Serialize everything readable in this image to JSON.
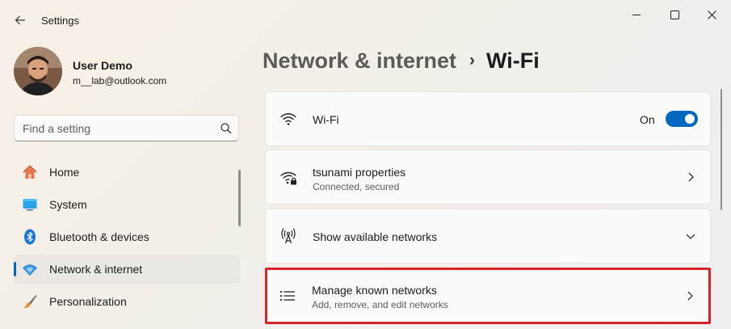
{
  "window": {
    "title": "Settings",
    "back_icon": "arrow-left-icon",
    "controls": {
      "minimize_icon": "minimize-icon",
      "maximize_icon": "maximize-icon",
      "close_icon": "close-icon"
    }
  },
  "user": {
    "name": "User Demo",
    "email": "m__lab@outlook.com"
  },
  "search": {
    "placeholder": "Find a setting",
    "value": "",
    "icon": "search-icon"
  },
  "sidebar": {
    "items": [
      {
        "label": "Home",
        "icon": "home-icon",
        "selected": false
      },
      {
        "label": "System",
        "icon": "monitor-icon",
        "selected": false
      },
      {
        "label": "Bluetooth & devices",
        "icon": "bluetooth-icon",
        "selected": false
      },
      {
        "label": "Network & internet",
        "icon": "wifi-diamond-icon",
        "selected": true
      },
      {
        "label": "Personalization",
        "icon": "paintbrush-icon",
        "selected": false
      }
    ]
  },
  "breadcrumb": {
    "parent": "Network & internet",
    "separator": "›",
    "current": "Wi-Fi"
  },
  "cards": {
    "wifi": {
      "title": "Wi-Fi",
      "icon": "wifi-icon",
      "toggle_state": "On",
      "toggle_on": true
    },
    "properties": {
      "title": "tsunami properties",
      "subtitle": "Connected, secured",
      "icon": "wifi-lock-icon",
      "action_icon": "chevron-right-icon"
    },
    "available": {
      "title": "Show available networks",
      "icon": "antenna-icon",
      "action_icon": "chevron-down-icon"
    },
    "known": {
      "title": "Manage known networks",
      "subtitle": "Add, remove, and edit networks",
      "icon": "list-icon",
      "action_icon": "chevron-right-icon"
    }
  },
  "colors": {
    "accent": "#0067c0",
    "highlight_border": "#d8232a"
  }
}
